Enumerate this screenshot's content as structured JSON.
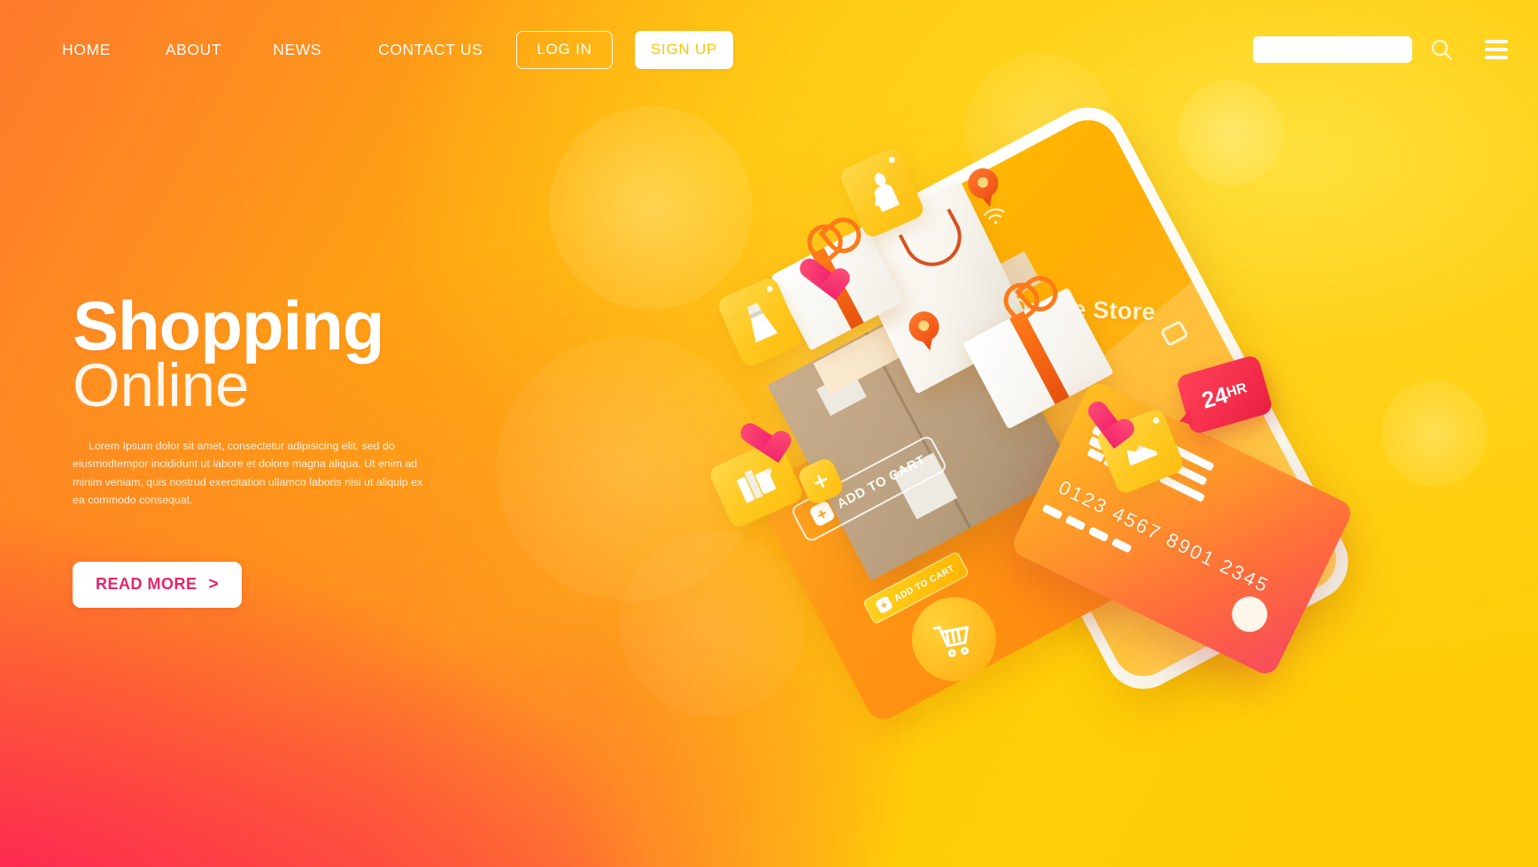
{
  "nav": {
    "links": [
      {
        "label": "HOME"
      },
      {
        "label": "ABOUT"
      },
      {
        "label": "NEWS"
      },
      {
        "label": "CONTACT US"
      }
    ],
    "login_label": "LOG IN",
    "signup_label": "SIGN UP",
    "search_value": "",
    "search_placeholder": "",
    "search_icon": "search-icon",
    "menu_icon": "hamburger-menu-icon"
  },
  "hero": {
    "title": "Shopping",
    "subtitle": "Online",
    "paragraph": "Lorem Ipsum dolor sit amet, consectetur adipisicing elit, sed do eiusmodtempor incididunt ut labore et dolore magna aliqua. Ut enim ad minim veniam, quis nostrud exercitation ullamco laboris nisi ut aliquip ex ea commodo consequat.",
    "cta_label": "READ MORE",
    "cta_chevron": ">"
  },
  "illustration": {
    "phone": {
      "app_title": "Online Store",
      "back_icon": "back-chevron-icon",
      "wifi_icon": "wifi-icon",
      "signal_icon": "signal-dots-icon",
      "menu_icon": "hamburger-menu-icon",
      "cart_icon": "shopping-cart-icon",
      "next_icon": "forward-chevron-icon",
      "card_icon": "card-icon"
    },
    "credit_card": {
      "number": "0123 4567 8901 2345",
      "chip_icon": "card-chip-icon"
    },
    "badge": {
      "number": "24",
      "unit": "HR"
    },
    "add_to_cart_primary": "ADD TO CART",
    "add_to_cart_secondary": "ADD TO CART",
    "plus_symbol": "+",
    "tiles": [
      {
        "icon": "person-shirt-icon"
      },
      {
        "icon": "dress-icon"
      },
      {
        "icon": "books-icon"
      },
      {
        "icon": "shoe-icon"
      },
      {
        "icon": "plus-icon"
      }
    ],
    "decor": [
      {
        "icon": "heart-icon"
      },
      {
        "icon": "heart-icon"
      },
      {
        "icon": "heart-icon"
      },
      {
        "icon": "map-pin-icon"
      },
      {
        "icon": "map-pin-icon"
      },
      {
        "icon": "gift-box-icon"
      },
      {
        "icon": "gift-box-icon"
      },
      {
        "icon": "shopping-bag-icon"
      },
      {
        "icon": "cardboard-box-icon"
      }
    ]
  },
  "colors": {
    "yellow": "#FFC800",
    "orange": "#FF8A22",
    "pink": "#FC2352",
    "cta_text": "#E3256B",
    "signup_text": "#FFC400",
    "badge_red": "#F42D4B"
  }
}
